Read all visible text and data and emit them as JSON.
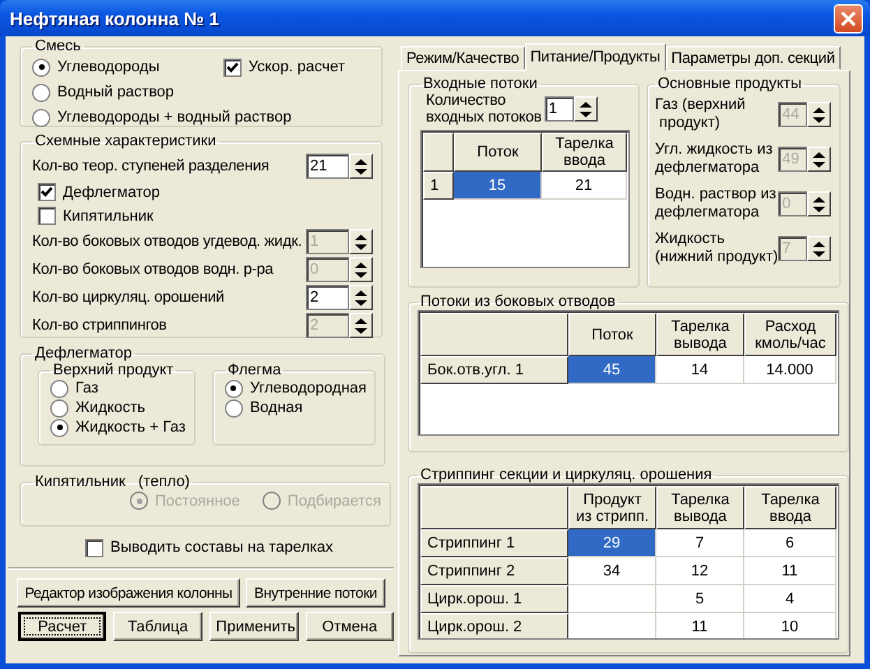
{
  "window": {
    "title": "Нефтяная колонна № 1"
  },
  "mixture": {
    "title": "Смесь",
    "options": [
      {
        "label": "Углеводороды",
        "selected": true
      },
      {
        "label": "Водный раствор",
        "selected": false
      },
      {
        "label": "Углеводороды + водный раствор",
        "selected": false
      }
    ],
    "fast_calc": {
      "label": "Ускор. расчет",
      "checked": true
    }
  },
  "scheme": {
    "title": "Схемные характеристики",
    "items": [
      {
        "kind": "spinner",
        "label": "Кол-во теор. ступеней разделения",
        "value": "21",
        "disabled": false
      },
      {
        "kind": "checkbox",
        "label": "Дефлегматор",
        "checked": true
      },
      {
        "kind": "checkbox",
        "label": "Кипятильник",
        "checked": false
      },
      {
        "kind": "spinner",
        "label": "Кол-во боковых отводов угдевод. жидк.",
        "value": "1",
        "disabled": true
      },
      {
        "kind": "spinner",
        "label": "Кол-во боковых отводов водн. р-ра",
        "value": "0",
        "disabled": true
      },
      {
        "kind": "spinner",
        "label": "Кол-во циркуляц. орошений",
        "value": "2",
        "disabled": false
      },
      {
        "kind": "spinner",
        "label": "Кол-во стриппингов",
        "value": "2",
        "disabled": true
      }
    ]
  },
  "condenser": {
    "title": "Дефлегматор",
    "top_product": {
      "title": "Верхний продукт",
      "options": [
        {
          "label": "Газ",
          "selected": false
        },
        {
          "label": "Жидкость",
          "selected": false
        },
        {
          "label": "Жидкость + Газ",
          "selected": true
        }
      ]
    },
    "reflux": {
      "title": "Флегма",
      "options": [
        {
          "label": "Углеводородная",
          "selected": true
        },
        {
          "label": "Водная",
          "selected": false
        }
      ]
    }
  },
  "reboiler": {
    "title": "Кипятильник   (тепло)",
    "disabled": true,
    "options": [
      {
        "label": "Постоянное",
        "selected": true
      },
      {
        "label": "Подбирается",
        "selected": false
      }
    ]
  },
  "print_checkbox": {
    "label": "Выводить составы на тарелках",
    "checked": false
  },
  "buttons_top": [
    {
      "label": "Редактор изображения колонны",
      "default": false
    },
    {
      "label": "Внутренние потоки",
      "default": false
    }
  ],
  "buttons_bottom": [
    {
      "label": "Расчет",
      "default": true
    },
    {
      "label": "Таблица",
      "default": false
    },
    {
      "label": "Применить",
      "default": false
    },
    {
      "label": "Отмена",
      "default": false
    }
  ],
  "tabs": [
    {
      "label": "Режим/Качество",
      "selected": false
    },
    {
      "label": "Питание/Продукты",
      "selected": true
    },
    {
      "label": "Параметры доп. секций",
      "selected": false
    }
  ],
  "inlet": {
    "title": "Входные потоки",
    "count": {
      "label": "Количество\nвходных потоков",
      "value": "1",
      "disabled": false
    },
    "table": {
      "columns": [
        "Поток",
        "Тарелка\nввода"
      ],
      "rows": [
        {
          "header": "1",
          "cells": [
            {
              "text": "15",
              "selected": true
            },
            {
              "text": "21",
              "selected": false
            }
          ]
        }
      ]
    }
  },
  "products": {
    "title": "Основные продукты",
    "items": [
      {
        "label": "Газ (верхний\n продукт)",
        "value": "44",
        "disabled": true
      },
      {
        "label": "Угл. жидкость из\nдефлегматора",
        "value": "49",
        "disabled": true
      },
      {
        "label": "Водн. раствор из\nдефлегматора",
        "value": "0",
        "disabled": true
      },
      {
        "label": "Жидкость\n(нижний продукт)",
        "value": "7",
        "disabled": true
      }
    ]
  },
  "side_streams": {
    "title": "Потоки из боковых отводов",
    "table": {
      "columns": [
        "Поток",
        "Тарелка\nвывода",
        "Расход\nкмоль/час"
      ],
      "rows": [
        {
          "header": "Бок.отв.угл. 1",
          "cells": [
            {
              "text": "45",
              "selected": true
            },
            {
              "text": "14",
              "selected": false
            },
            {
              "text": "14.000",
              "selected": false
            }
          ]
        }
      ]
    }
  },
  "stripping": {
    "title": "Стриппинг секции и циркуляц. орошения",
    "table": {
      "columns": [
        "Продукт\nиз стрипп.",
        "Тарелка\nвывода",
        "Тарелка\nввода"
      ],
      "rows": [
        {
          "header": "Стриппинг 1",
          "cells": [
            {
              "text": "29",
              "selected": true
            },
            {
              "text": "7",
              "selected": false
            },
            {
              "text": "6",
              "selected": false
            }
          ]
        },
        {
          "header": "Стриппинг 2",
          "cells": [
            {
              "text": "34",
              "selected": false
            },
            {
              "text": "12",
              "selected": false
            },
            {
              "text": "11",
              "selected": false
            }
          ]
        },
        {
          "header": "Цирк.орош. 1",
          "cells": [
            {
              "selected": false
            },
            {
              "text": "5",
              "selected": false
            },
            {
              "text": "4",
              "selected": false
            }
          ]
        },
        {
          "header": "Цирк.орош. 2",
          "cells": [
            {
              "selected": false
            },
            {
              "text": "11",
              "selected": false
            },
            {
              "text": "10",
              "selected": false
            }
          ]
        }
      ]
    }
  }
}
